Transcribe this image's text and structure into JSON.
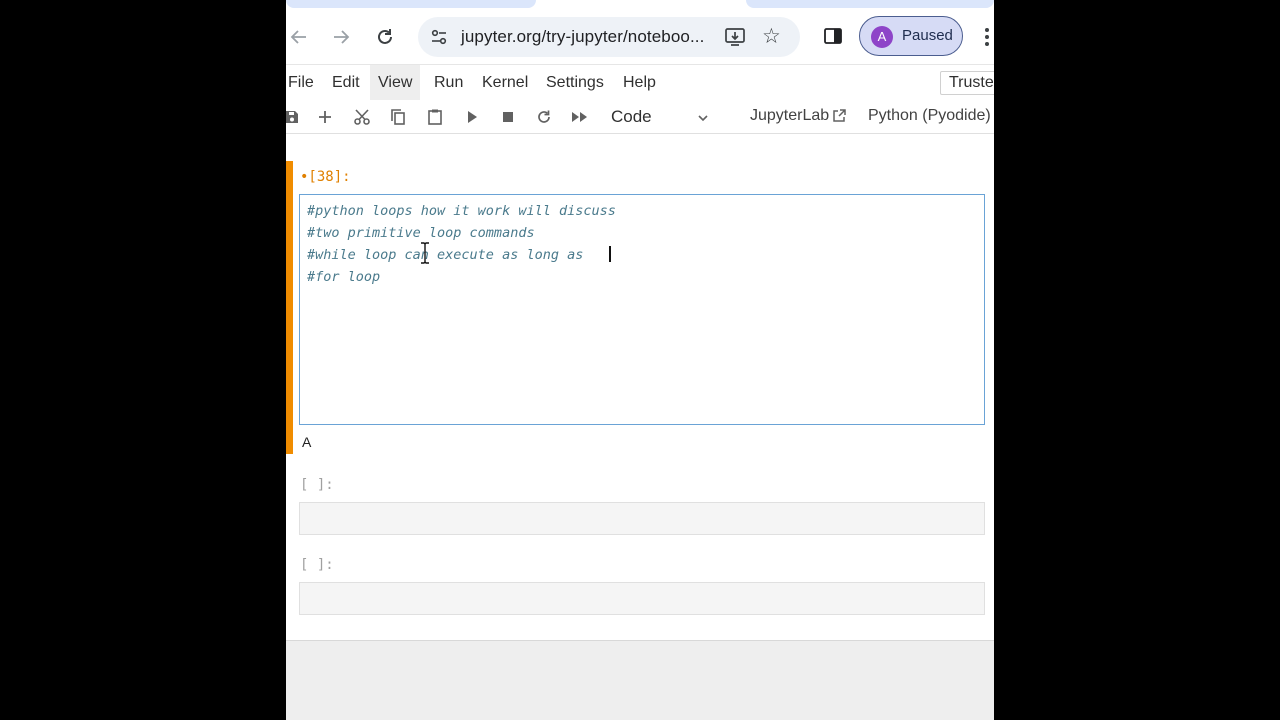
{
  "browser": {
    "url": "jupyter.org/try-jupyter/noteboo...",
    "profile_initial": "A",
    "profile_status": "Paused"
  },
  "menubar": {
    "items": [
      "File",
      "Edit",
      "View",
      "Run",
      "Kernel",
      "Settings",
      "Help"
    ],
    "active": "View",
    "trusted_label": "Truste"
  },
  "toolbar": {
    "cell_type": "Code",
    "jupyterlab_link": "JupyterLab",
    "kernel_name": "Python (Pyodide)"
  },
  "cells": {
    "active": {
      "prompt": "•[38]:",
      "lines": [
        "#python loops how it work will discuss",
        "#two primitive loop commands",
        "#while loop can execute as long as ",
        "#for loop"
      ],
      "output": "A"
    },
    "empty": [
      {
        "prompt": "[ ]:"
      },
      {
        "prompt": "[ ]:"
      }
    ]
  },
  "colors": {
    "accent": "#f08c00",
    "editor_border": "#6aa3d6",
    "comment_text": "#4a7a8c"
  }
}
